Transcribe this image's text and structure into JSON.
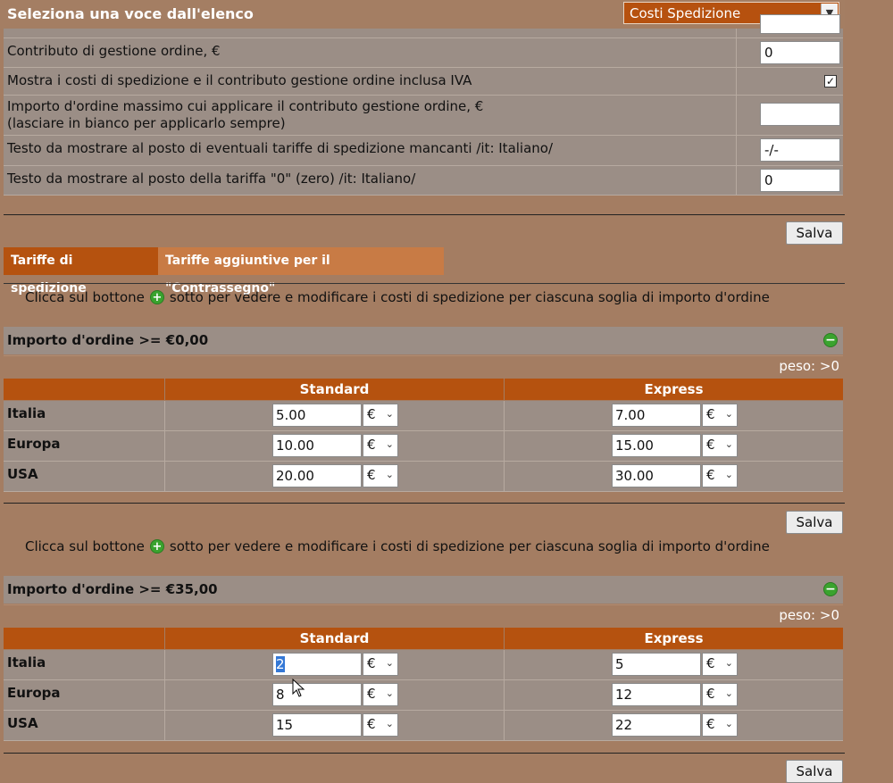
{
  "top": {
    "title": "Seleziona una voce dall'elenco",
    "select_value": "Costi Spedizione",
    "select_arrow": "▼"
  },
  "settings": [
    {
      "label": "Contributo di gestione ordine, €",
      "value": "0",
      "type": "text"
    },
    {
      "label": "Mostra i costi di spedizione e il contributo gestione ordine inclusa IVA",
      "checked": true,
      "type": "checkbox"
    },
    {
      "label_line1": "Importo d'ordine massimo cui applicare il contributo gestione ordine, €",
      "label_line2": "(lasciare in bianco per applicarlo sempre)",
      "value": "",
      "type": "text"
    },
    {
      "label": "Testo da mostrare al posto di eventuali tariffe di spedizione mancanti /it: Italiano/",
      "value": "-/-",
      "type": "text"
    },
    {
      "label": "Testo da mostrare al posto della tariffa \"0\" (zero) /it: Italiano/",
      "value": "0",
      "type": "text"
    }
  ],
  "save_label": "Salva",
  "tabs": [
    {
      "label": "Tariffe di spedizione",
      "active": true
    },
    {
      "label": "Tariffe aggiuntive per il \"Contrassegno\"",
      "active": false
    }
  ],
  "hint": {
    "before": "Clicca sul bottone",
    "after": "sotto per vedere e modificare i costi di spedizione per ciascuna soglia di importo d'ordine"
  },
  "icons": {
    "plus": "+",
    "minus": "−",
    "check": "✓",
    "chevron": "⌄"
  },
  "columns": {
    "standard": "Standard",
    "express": "Express"
  },
  "currency": "€",
  "tiers": [
    {
      "title": "Importo d'ordine >= €0,00",
      "peso": "peso: >0",
      "rows": [
        {
          "country": "Italia",
          "standard": "5.00",
          "express": "7.00"
        },
        {
          "country": "Europa",
          "standard": "10.00",
          "express": "15.00"
        },
        {
          "country": "USA",
          "standard": "20.00",
          "express": "30.00"
        }
      ]
    },
    {
      "title": "Importo d'ordine >= €35,00",
      "peso": "peso: >0",
      "rows": [
        {
          "country": "Italia",
          "standard": "2",
          "express": "5"
        },
        {
          "country": "Europa",
          "standard": "8",
          "express": "12"
        },
        {
          "country": "USA",
          "standard": "15",
          "express": "22"
        }
      ]
    }
  ]
}
